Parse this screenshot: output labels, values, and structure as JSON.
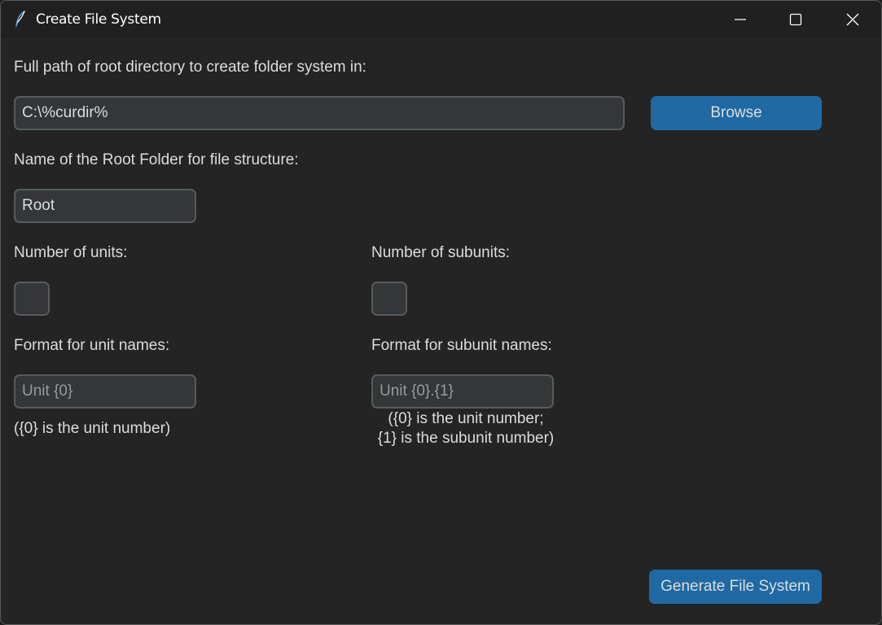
{
  "window": {
    "title": "Create File System",
    "app_icon": "feather-icon",
    "controls": {
      "minimize_icon": "minimize-icon",
      "maximize_icon": "maximize-icon",
      "close_icon": "close-icon"
    }
  },
  "colors": {
    "background": "#242424",
    "titlebar": "#202020",
    "field_bg": "#343638",
    "field_border": "#565b5e",
    "accent": "#1f6aa5",
    "text": "#dcdcdc"
  },
  "root_path": {
    "label": "Full path of root directory to create folder system in:",
    "value": "C:\\%curdir%",
    "browse_label": "Browse"
  },
  "root_folder": {
    "label": "Name of the Root Folder for file structure:",
    "value": "Root"
  },
  "units": {
    "count_label": "Number of units:",
    "count_value": "",
    "format_label": "Format for unit names:",
    "format_placeholder": "Unit {0}",
    "format_note": "({0} is the unit number)"
  },
  "subunits": {
    "count_label": "Number of subunits:",
    "count_value": "",
    "format_label": "Format for subunit names:",
    "format_placeholder": "Unit {0}.{1}",
    "format_note_line1": "({0} is the unit number;",
    "format_note_line2": "{1} is the subunit number)"
  },
  "actions": {
    "generate_label": "Generate File System"
  }
}
